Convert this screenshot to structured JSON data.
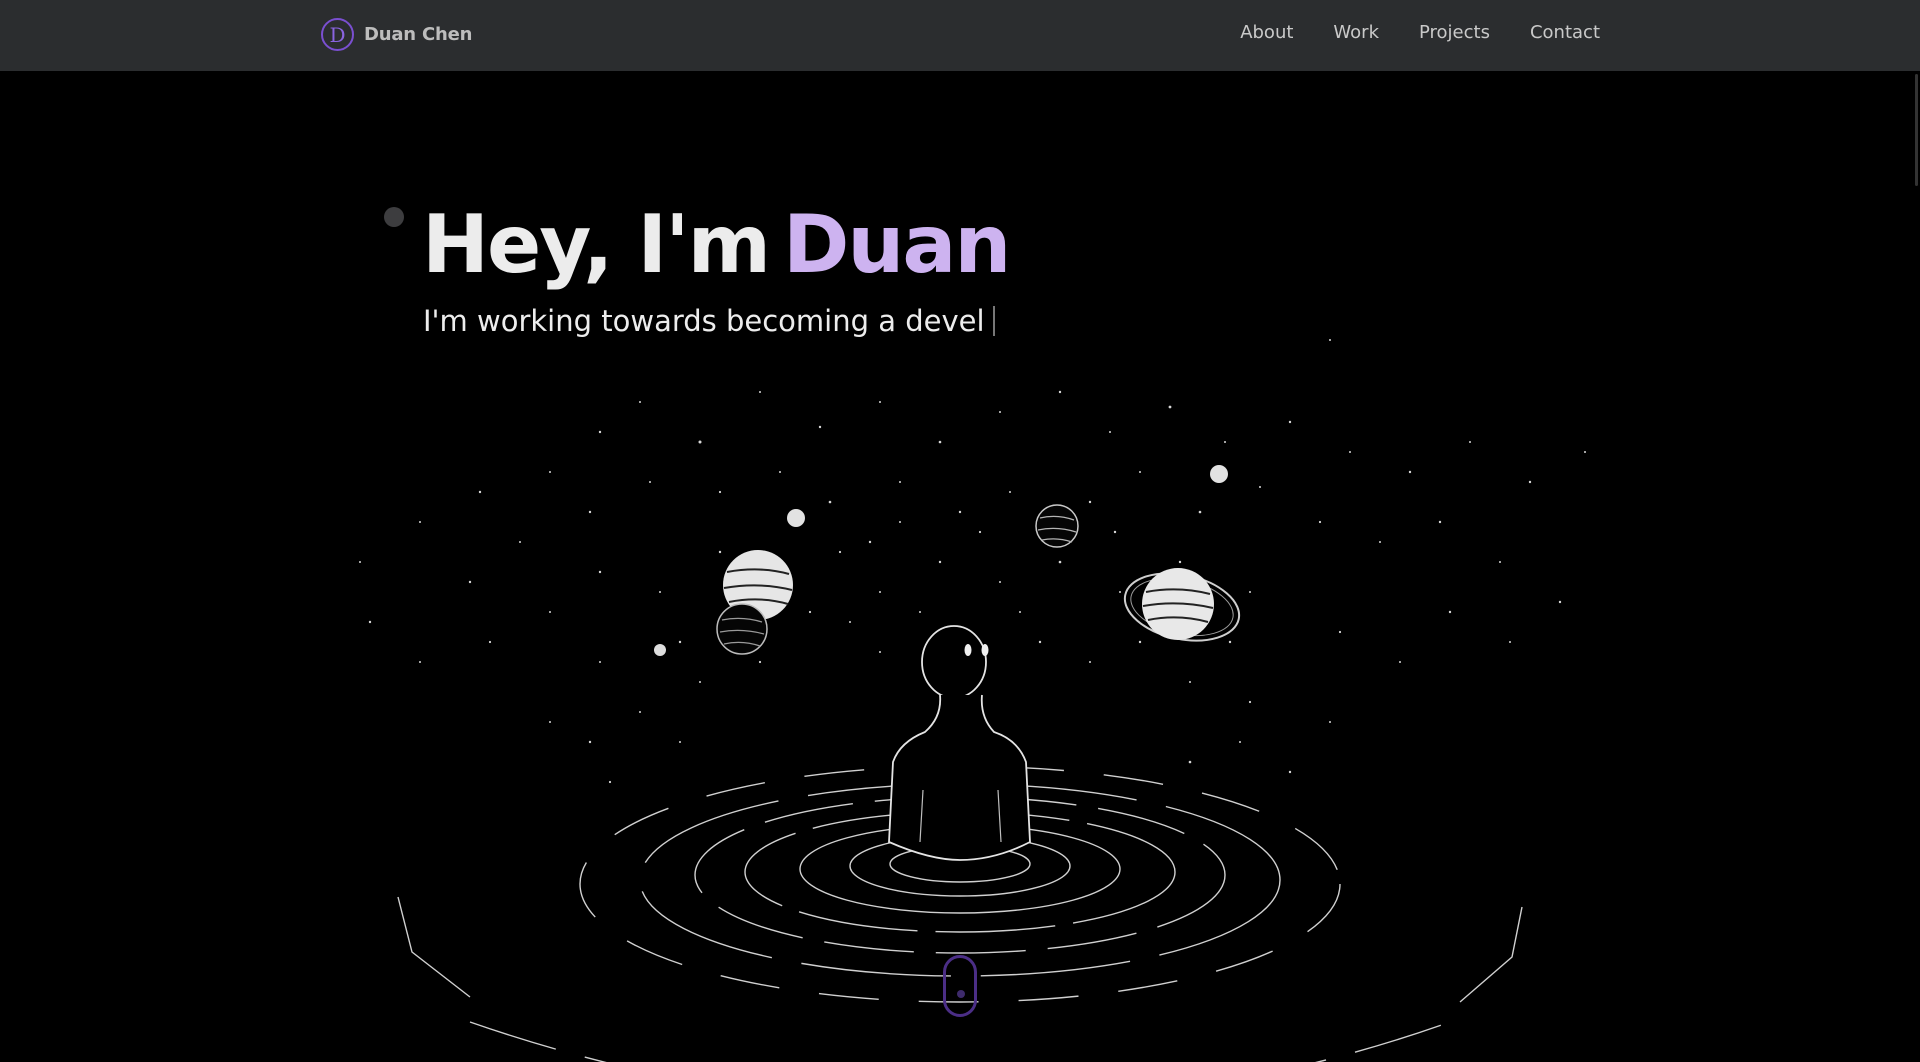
{
  "brand": {
    "logo_letter": "D",
    "name": "Duan Chen"
  },
  "nav": {
    "items": [
      {
        "label": "About"
      },
      {
        "label": "Work"
      },
      {
        "label": "Projects"
      },
      {
        "label": "Contact"
      }
    ]
  },
  "hero": {
    "greeting": "Hey, I'm",
    "name": "Duan",
    "subtitle": "I'm working towards becoming a devel"
  },
  "illustration": {
    "icons": [
      "planet-icon",
      "moon-icon",
      "star-icon",
      "person-icon",
      "ripple-icon"
    ]
  },
  "scroll_indicator": {
    "icon": "mouse-icon"
  },
  "colors": {
    "navbar_bg": "#2b2d2f",
    "page_bg": "#000000",
    "accent": "#cdb3f0",
    "logo_accent": "#7a4fd0",
    "scroll_indicator": "#4b2e86"
  }
}
